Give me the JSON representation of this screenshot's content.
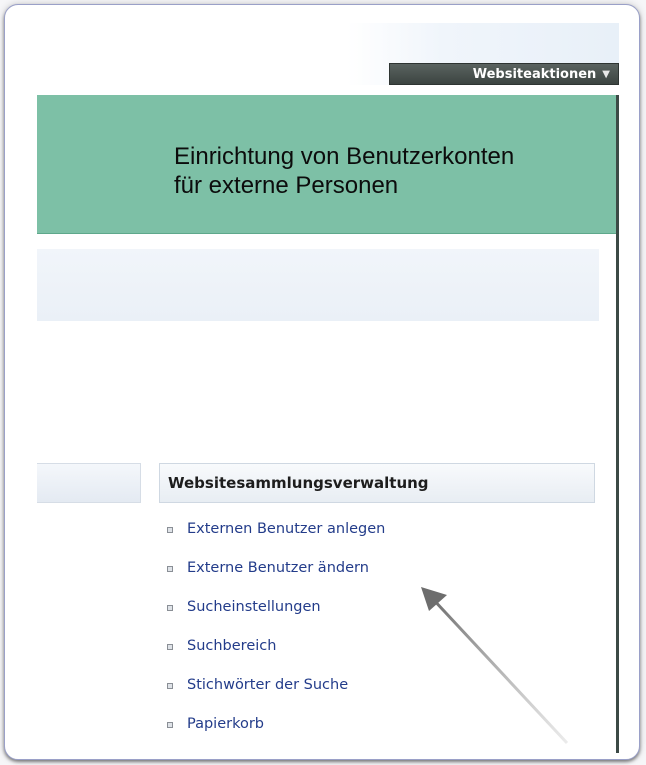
{
  "header": {
    "site_actions_label": "Websiteaktionen",
    "site_actions_arrow": "▼"
  },
  "banner": {
    "title": "Einrichtung von Benutzerkonten\nfür externe Personen"
  },
  "admin_section": {
    "title": "Websitesammlungsverwaltung",
    "links": [
      {
        "label": "Externen Benutzer anlegen"
      },
      {
        "label": "Externe Benutzer ändern"
      },
      {
        "label": "Sucheinstellungen"
      },
      {
        "label": "Suchbereich"
      },
      {
        "label": "Stichwörter der Suche"
      },
      {
        "label": "Papierkorb"
      }
    ]
  },
  "colors": {
    "banner": "#7dc0a6",
    "link": "#233c8a",
    "site_actions_bg": "#4a5350"
  }
}
